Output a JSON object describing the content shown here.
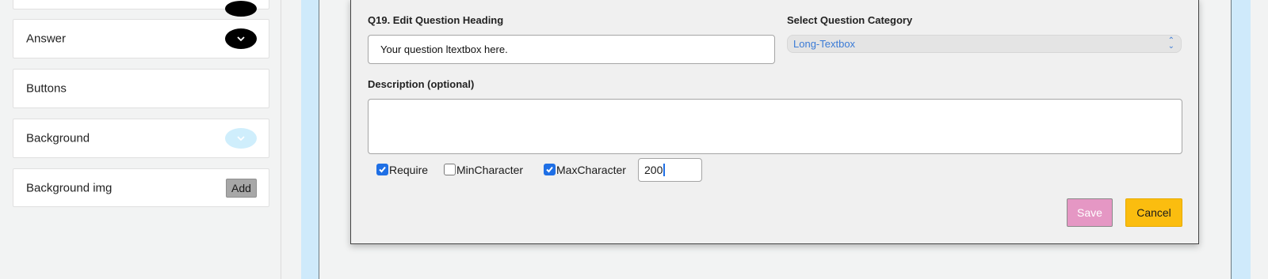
{
  "sidebar": {
    "items": [
      {
        "label": ""
      },
      {
        "label": "Answer",
        "control": "toggle",
        "toggle_color": "#000000"
      },
      {
        "label": "Buttons"
      },
      {
        "label": "Background",
        "control": "toggle",
        "toggle_color": "#cfeefc"
      },
      {
        "label": "Background img",
        "control": "button",
        "button_label": "Add"
      }
    ]
  },
  "editor": {
    "heading_label": "Q19. Edit Question Heading",
    "heading_value": "Your question ltextbox here.",
    "category_label": "Select Question Category",
    "category_value": "Long-Textbox",
    "description_label": "Description (optional)",
    "description_value": "",
    "options": {
      "require": {
        "label": "Require",
        "checked": true
      },
      "min_character": {
        "label": "MinCharacter",
        "checked": false
      },
      "max_character": {
        "label": "MaxCharacter",
        "checked": true,
        "value": "200"
      }
    },
    "save_label": "Save",
    "cancel_label": "Cancel"
  },
  "colors": {
    "accent_blue": "#1f6fe5",
    "save_button": "#e597c4",
    "cancel_button": "#fbbd0f",
    "frame_blue": "#cfeafb"
  }
}
